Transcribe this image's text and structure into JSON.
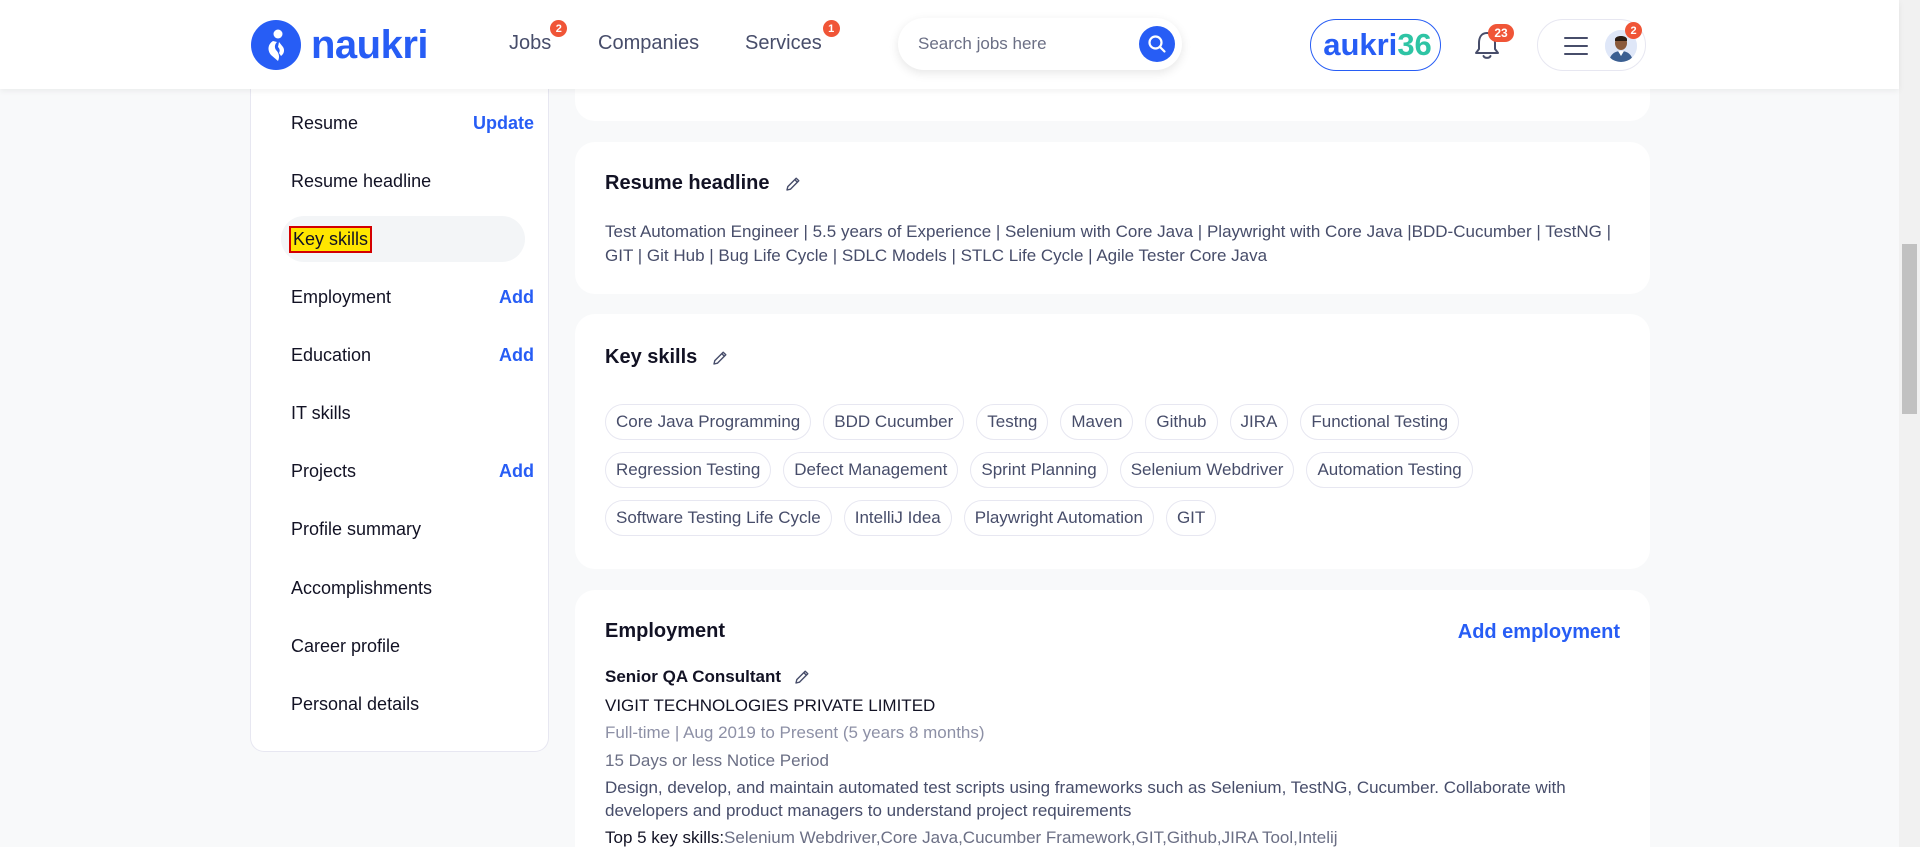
{
  "brand": {
    "logo_text": "naukri",
    "accent": "#275df5"
  },
  "nav": [
    {
      "label": "Jobs",
      "badge": "2"
    },
    {
      "label": "Companies",
      "badge": ""
    },
    {
      "label": "Services",
      "badge": "1"
    }
  ],
  "search": {
    "placeholder": "Search jobs here"
  },
  "naukri360": {
    "part1": "aukri",
    "part2": "36"
  },
  "notifications": {
    "badge": "23"
  },
  "user_menu": {
    "badge": "2"
  },
  "sidebar": {
    "items": [
      {
        "label": "Resume",
        "action": "Update"
      },
      {
        "label": "Resume headline",
        "action": ""
      },
      {
        "label": "Key skills",
        "action": ""
      },
      {
        "label": "Employment",
        "action": "Add"
      },
      {
        "label": "Education",
        "action": "Add"
      },
      {
        "label": "IT skills",
        "action": ""
      },
      {
        "label": "Projects",
        "action": "Add"
      },
      {
        "label": "Profile summary",
        "action": ""
      },
      {
        "label": "Accomplishments",
        "action": ""
      },
      {
        "label": "Career profile",
        "action": ""
      },
      {
        "label": "Personal details",
        "action": ""
      }
    ]
  },
  "resume_headline": {
    "title": "Resume headline",
    "text": "Test Automation Engineer | 5.5 years of Experience | Selenium with Core Java | Playwright with Core Java |BDD-Cucumber | TestNG | GIT | Git Hub | Bug Life Cycle | SDLC Models | STLC Life Cycle | Agile Tester Core Java"
  },
  "key_skills": {
    "title": "Key skills",
    "skills": [
      "Core Java Programming",
      "BDD Cucumber",
      "Testng",
      "Maven",
      "Github",
      "JIRA",
      "Functional Testing",
      "Regression Testing",
      "Defect Management",
      "Sprint Planning",
      "Selenium Webdriver",
      "Automation Testing",
      "Software Testing Life Cycle",
      "IntelliJ Idea",
      "Playwright Automation",
      "GIT"
    ]
  },
  "employment": {
    "title": "Employment",
    "add_label": "Add employment",
    "role": "Senior QA Consultant",
    "company": "VIGIT TECHNOLOGIES PRIVATE LIMITED",
    "meta": "Full-time | Aug 2019 to Present (5 years 8 months)",
    "notice": "15 Days or less Notice Period",
    "description": "Design, develop, and maintain automated test scripts using frameworks such as Selenium, TestNG, Cucumber. Collaborate with developers and product managers to understand project requirements",
    "top_skills_label": "Top 5 key skills:",
    "top_skills": "Selenium Webdriver,Core Java,Cucumber Framework,GIT,Github,JIRA Tool,Intelij"
  }
}
